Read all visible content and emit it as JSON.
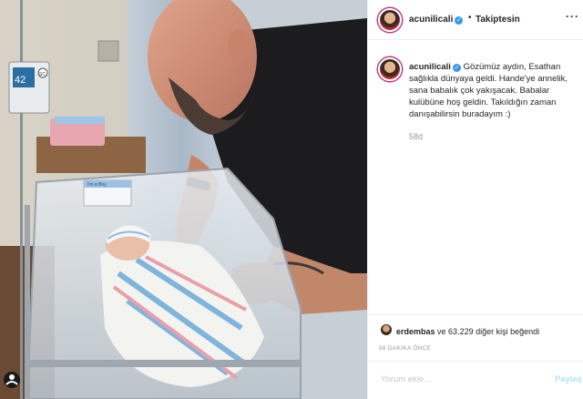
{
  "post": {
    "username": "acunilicali",
    "verified": true,
    "follow_state": "Takiptesin",
    "separator": "•",
    "more_icon": "more-horizontal-icon",
    "caption": "Gözümüz aydın, Esathan sağlıkla dünyaya geldi. Hande'ye annelik, sana babalık çok yakışacak. Babalar kulübüne hoş geldin. Takıldığın zaman danışabilirsin buradayım :)",
    "time_ago": "58d",
    "likes_user": "erdembas",
    "likes_rest": "ve 63.229 diğer kişi beğendi",
    "posted_ago": "58 DAKİKA ÖNCE",
    "comment_placeholder": "Yorum ekle...",
    "post_button": "Paylaş"
  },
  "photo": {
    "monitor_reading": "42",
    "monitor_number": "SC",
    "crib_card": "I'm a Boy"
  },
  "colors": {
    "verified_blue": "#3897f0",
    "muted_text": "#999999",
    "post_button_disabled": "#b2dffc"
  }
}
